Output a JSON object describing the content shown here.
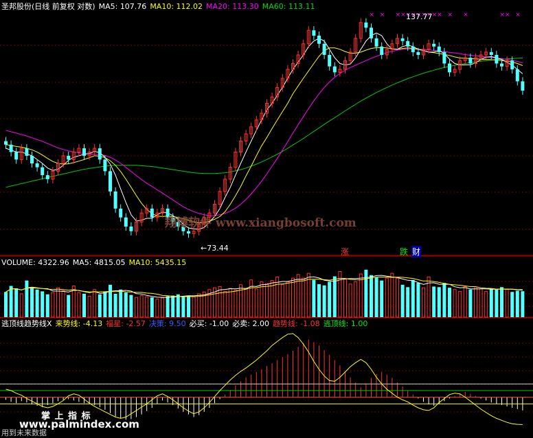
{
  "price_header": {
    "name": "圣邦股份(日线 前复权 对数)",
    "ma5_label": "MA5:",
    "ma5_value": "107.76",
    "ma10_label": "MA10:",
    "ma10_value": "112.02",
    "ma20_label": "MA20:",
    "ma20_value": "113.30",
    "ma60_label": "MA60:",
    "ma60_value": "113.11"
  },
  "volume_header": {
    "label": "VOLUME:",
    "value": "4322.96",
    "ma5_label": "MA5:",
    "ma5_value": "4815.05",
    "ma10_label": "MA10:",
    "ma10_value": "5435.15"
  },
  "indicator_header": {
    "name": "逃顶线趋势线X",
    "lai_label": "来势线:",
    "lai_value": "-4.13",
    "fu_label": "福星",
    "fu_value": "-2.57",
    "jue_label": "决策",
    "jue_value": "9.50",
    "buy_label": "必买:",
    "buy_value": "-1.00",
    "sell_label": "必卖:",
    "sell_value": "2.00",
    "trend_label": "趋势线",
    "trend_value": "-1.08",
    "escape_label": "逃顶线:",
    "escape_value": "1.00"
  },
  "annotations": {
    "high": "137.77",
    "low": "←73.44",
    "zhang": "涨",
    "die": "跌",
    "cai": "财",
    "watermark": "翔博软件 www.xiangbosoft.com",
    "footer_brand": "掌 上 指 标",
    "footer_url": "www.palmindex.com",
    "footer_note": "用到未来数据"
  },
  "colors": {
    "up": "#ff3232",
    "down": "#54ffff",
    "ma5": "#ffffff",
    "ma10": "#ffff00",
    "ma20": "#ff00ff",
    "ma60": "#00cc00",
    "grid": "#7a0000"
  },
  "chart_data": [
    {
      "type": "candlestick",
      "title": "圣邦股份(日线 前复权 对数)",
      "scale": "log",
      "ylim": [
        70,
        140
      ],
      "x": [
        1,
        2,
        3,
        4,
        5,
        6,
        7,
        8,
        9,
        10,
        11,
        12,
        13,
        14,
        15,
        16,
        17,
        18,
        19,
        20,
        21,
        22,
        23,
        24,
        25,
        26,
        27,
        28,
        29,
        30,
        31,
        32,
        33,
        34,
        35,
        36,
        37,
        38,
        39,
        40,
        41,
        42,
        43,
        44,
        45,
        46,
        47,
        48,
        49,
        50,
        51,
        52,
        53,
        54,
        55,
        56,
        57,
        58,
        59,
        60,
        61,
        62,
        63,
        64,
        65,
        66,
        67,
        68,
        69,
        70,
        71,
        72,
        73,
        74,
        75,
        76,
        77,
        78,
        79,
        80,
        81,
        82,
        83,
        84,
        85,
        86,
        87,
        88,
        89,
        90,
        91,
        92,
        93,
        94,
        95,
        96,
        97,
        98,
        99,
        100
      ],
      "close": [
        96,
        94,
        92,
        95,
        93,
        91,
        90,
        88,
        87,
        89,
        91,
        93,
        92,
        94,
        95,
        93,
        94,
        95,
        92,
        89,
        84,
        80,
        78,
        76,
        75,
        77,
        79,
        80,
        78,
        79,
        80,
        78,
        77,
        76,
        75,
        74.5,
        75,
        76.5,
        78,
        79,
        81,
        84,
        87,
        90,
        94,
        97,
        99,
        101,
        103,
        105,
        108,
        110,
        113,
        116,
        119,
        121,
        124,
        128,
        133,
        131,
        128,
        124,
        120,
        118,
        119,
        122,
        125,
        130,
        136,
        134,
        130,
        127,
        124,
        126,
        128,
        130,
        129,
        127,
        125,
        124,
        126,
        128,
        127,
        125,
        121,
        118,
        119,
        122,
        123,
        121,
        123,
        124,
        125,
        124,
        121,
        120,
        122,
        119,
        115,
        112
      ],
      "ma5": [
        95,
        94.5,
        94,
        94,
        93.5,
        93,
        92,
        91,
        89.8,
        89.2,
        89.5,
        90.5,
        91.8,
        92.6,
        93,
        93.4,
        93.6,
        94.2,
        93.8,
        92.6,
        90.8,
        88,
        84.6,
        81.4,
        78.6,
        77.2,
        77.4,
        77.8,
        77.8,
        78.6,
        79.2,
        79,
        78.4,
        77.6,
        76.5,
        75.7,
        75.5,
        75.4,
        75.8,
        77,
        78.2,
        80,
        82.6,
        85,
        88,
        91,
        94,
        97,
        100,
        103,
        106,
        108,
        110.5,
        113,
        116,
        119,
        121.5,
        124,
        127,
        129,
        130,
        129,
        126,
        123,
        121,
        120.5,
        120.8,
        123,
        126,
        129,
        131,
        132,
        131,
        128,
        126,
        126,
        127,
        127.5,
        127,
        126,
        125.5,
        125,
        125,
        125.5,
        124.5,
        122.5,
        121,
        120.5,
        120.5,
        120.6,
        121.2,
        122.4,
        123.2,
        123.4,
        123,
        122.4,
        121.4,
        120.4,
        119,
        117.5
      ],
      "ma10": [
        96,
        95.8,
        95.5,
        95.3,
        95,
        94.6,
        94,
        93.2,
        92.3,
        91.5,
        91,
        90.8,
        90.9,
        91.2,
        91.6,
        92,
        92.5,
        93,
        92.9,
        92.5,
        91.7,
        90.5,
        88.9,
        87,
        85,
        83,
        81.2,
        79.8,
        78.9,
        78.3,
        78.2,
        78.3,
        78.2,
        78,
        77.7,
        77.4,
        77,
        76.8,
        76.9,
        77.2,
        77.6,
        78.2,
        79.3,
        81,
        83,
        85.2,
        87.8,
        90.3,
        93,
        95.7,
        98,
        100.5,
        103,
        105.5,
        108,
        111,
        113.5,
        116,
        118.5,
        121,
        123.5,
        125.5,
        126.5,
        126.5,
        126,
        125.2,
        124.6,
        124.6,
        125,
        125.7,
        126.3,
        126.6,
        126.6,
        126.5,
        126.2,
        126,
        126.3,
        126.5,
        126.3,
        126,
        125.6,
        125,
        124.8,
        124.5,
        124.2,
        123.8,
        123.3,
        122.9,
        122.8,
        122.7,
        122.6,
        122.5,
        122.4,
        122.3,
        122.2,
        122,
        121.8,
        121.5,
        121,
        120.3
      ],
      "ma20": [
        100,
        99.6,
        99.2,
        98.8,
        98.4,
        97.9,
        97.4,
        96.9,
        96.3,
        95.7,
        95.1,
        94.7,
        94.3,
        94,
        93.8,
        93.6,
        93.5,
        93.4,
        93.3,
        93.1,
        92.6,
        91.9,
        91,
        90,
        88.9,
        87.9,
        86.9,
        86,
        85.2,
        84.4,
        83.6,
        82.8,
        82,
        81.2,
        80.4,
        79.8,
        79.3,
        78.9,
        78.6,
        78.4,
        78.4,
        78.6,
        78.9,
        79.4,
        80.1,
        81,
        82.1,
        83.4,
        84.9,
        86.5,
        88.3,
        90.3,
        92.3,
        94.5,
        96.8,
        99.2,
        101.6,
        104,
        106.4,
        108.8,
        111,
        113,
        114.8,
        116.3,
        117.6,
        118.7,
        119.6,
        120.4,
        121.2,
        122,
        122.8,
        123.5,
        124.2,
        124.8,
        125.3,
        125.7,
        126,
        126.1,
        126.1,
        126,
        125.9,
        125.8,
        125.6,
        125.4,
        125.2,
        124.9,
        124.7,
        124.4,
        124.1,
        123.9,
        123.7,
        123.5,
        123.3,
        123.1,
        122.9,
        122.7,
        122.4,
        122.1,
        121.7,
        121.2
      ],
      "ma60": [
        85,
        85.3,
        85.6,
        85.9,
        86.2,
        86.5,
        86.8,
        87.1,
        87.4,
        87.7,
        88,
        88.3,
        88.6,
        88.9,
        89.2,
        89.5,
        89.7,
        89.9,
        90.1,
        90.3,
        90.4,
        90.5,
        90.5,
        90.5,
        90.5,
        90.5,
        90.4,
        90.3,
        90.2,
        90,
        89.8,
        89.6,
        89.4,
        89.2,
        89,
        88.8,
        88.6,
        88.5,
        88.4,
        88.4,
        88.4,
        88.5,
        88.6,
        88.8,
        89.1,
        89.4,
        89.8,
        90.3,
        90.8,
        91.4,
        92,
        92.7,
        93.4,
        94.2,
        95,
        95.9,
        96.8,
        97.7,
        98.7,
        99.7,
        100.7,
        101.7,
        102.7,
        103.7,
        104.7,
        105.7,
        106.7,
        107.7,
        108.7,
        109.6,
        110.5,
        111.4,
        112.2,
        113,
        113.8,
        114.5,
        115.2,
        115.9,
        116.5,
        117.1,
        117.7,
        118.2,
        118.7,
        119.2,
        119.6,
        120,
        120.4,
        120.7,
        121,
        121.3,
        121.6,
        121.8,
        122,
        122.2,
        122.4,
        122.5,
        122.6,
        122.7,
        122.8,
        122.9
      ],
      "high_mark": 137.77,
      "low_mark": 73.44
    },
    {
      "type": "bar",
      "title": "VOLUME",
      "values": [
        4200,
        5200,
        4800,
        3900,
        6100,
        5000,
        4600,
        4300,
        3800,
        4100,
        4900,
        4400,
        3700,
        5200,
        4100,
        3900,
        3500,
        4600,
        3800,
        4300,
        5400,
        3900,
        4600,
        4100,
        3700,
        3300,
        3600,
        3400,
        3300,
        3000,
        3200,
        3500,
        3600,
        3800,
        3400,
        3600,
        3400,
        3900,
        4200,
        4600,
        4900,
        5100,
        4300,
        4800,
        4500,
        5400,
        4800,
        6200,
        4700,
        5900,
        5600,
        6100,
        6700,
        5400,
        5900,
        6500,
        7100,
        6500,
        7300,
        6200,
        5500,
        5300,
        5900,
        6800,
        7600,
        6300,
        5500,
        5900,
        7200,
        7900,
        7000,
        6600,
        6100,
        6500,
        7300,
        6500,
        5400,
        5000,
        6200,
        5700,
        4900,
        6700,
        5100,
        5000,
        5700,
        4900,
        4600,
        4300,
        5100,
        4600,
        4900,
        4700,
        4300,
        4800,
        4600,
        5000,
        4600,
        4200,
        4400,
        4323
      ],
      "ma5_value": 4815.05,
      "ma10_value": 5435.15
    },
    {
      "type": "bar",
      "title": "逃顶线趋势线X",
      "values": [
        -0.4,
        -0.7,
        -0.9,
        -0.6,
        -0.8,
        -1.1,
        -1.3,
        -1.5,
        -1.2,
        -0.9,
        -0.6,
        -0.4,
        -0.3,
        -0.5,
        -0.7,
        -0.9,
        -1.0,
        -1.2,
        -1.5,
        -1.9,
        -2.4,
        -2.9,
        -3.2,
        -3.4,
        -3.3,
        -3.0,
        -2.6,
        -2.1,
        -1.6,
        -1.0,
        -0.5,
        -0.8,
        -1.2,
        -1.7,
        -2.2,
        -2.6,
        -3.0,
        -2.7,
        -2.2,
        -1.6,
        -0.9,
        -0.3,
        0.4,
        1.1,
        1.8,
        2.4,
        3.0,
        3.4,
        3.8,
        4.2,
        4.7,
        5.1,
        5.6,
        6.0,
        6.5,
        7.0,
        7.6,
        8.2,
        8.7,
        8.3,
        7.8,
        7.1,
        6.4,
        5.6,
        4.8,
        3.9,
        3.0,
        2.2,
        1.5,
        2.1,
        2.9,
        3.5,
        3.8,
        3.4,
        2.9,
        2.2,
        1.6,
        1.0,
        0.4,
        -0.2,
        -0.7,
        -1.1,
        -1.3,
        -1.0,
        -0.6,
        -0.2,
        0.2,
        0.5,
        0.8,
        0.5,
        0.2,
        -0.2,
        -0.5,
        -0.8,
        -1.0,
        -1.2,
        -1.4,
        -1.6,
        -1.8,
        -2.0
      ],
      "lai_line": [
        1.2,
        1.0,
        0.6,
        0.3,
        -0.2,
        -0.6,
        -1.0,
        -1.4,
        -1.6,
        -1.4,
        -1.0,
        -0.5,
        0.2,
        0.5,
        0.3,
        -0.3,
        -0.9,
        -1.4,
        -1.8,
        -2.2,
        -2.6,
        -3.0,
        -3.2,
        -3.0,
        -2.5,
        -2.0,
        -1.5,
        -1.0,
        -0.4,
        0.2,
        0.5,
        0.1,
        -0.4,
        -1.0,
        -1.6,
        -2.1,
        -2.5,
        -2.2,
        -1.6,
        -0.8,
        0.1,
        1.0,
        1.8,
        2.6,
        3.3,
        3.9,
        4.4,
        5.0,
        5.6,
        6.3,
        7.0,
        7.8,
        8.4,
        9.0,
        9.5,
        9.6,
        9.0,
        8.0,
        6.8,
        5.4,
        4.2,
        3.2,
        2.5,
        2.4,
        3.0,
        3.8,
        4.6,
        5.2,
        5.7,
        5.2,
        4.2,
        3.0,
        2.0,
        1.2,
        0.6,
        0.0,
        -0.4,
        -0.7,
        -1.2,
        -1.6,
        -1.9,
        -2.0,
        -1.6,
        -0.8,
        -0.2,
        0.4,
        0.6,
        0.5,
        0.0,
        -0.6,
        -1.2,
        -1.8,
        -2.3,
        -2.8,
        -3.2,
        -3.5,
        -3.8,
        -4.0,
        -4.1,
        -4.13
      ],
      "ylim": [
        -4.5,
        10
      ],
      "buy_line": -1.0,
      "sell_line": 2.0,
      "escape_line": 1.0
    }
  ]
}
